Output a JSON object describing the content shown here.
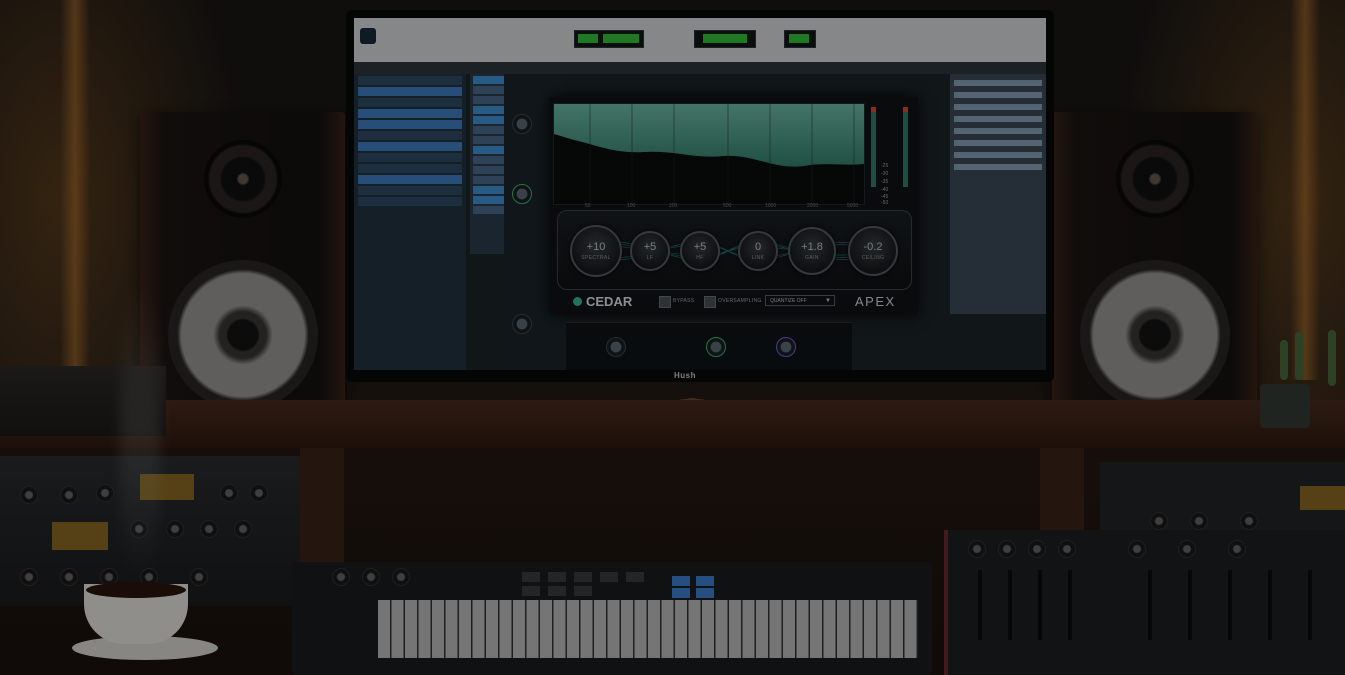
{
  "monitor": {
    "brand": "Hush"
  },
  "plugin": {
    "frequency_labels": [
      "50",
      "100",
      "200",
      "500",
      "1000",
      "2000",
      "5000"
    ],
    "meter_labels": [
      "-25",
      "-30",
      "-35",
      "-40",
      "-45",
      "-50"
    ],
    "knobs": [
      {
        "value": "+10",
        "label": "SPECTRAL"
      },
      {
        "value": "+5",
        "label": "LF"
      },
      {
        "value": "+5",
        "label": "HF"
      },
      {
        "value": "0",
        "label": "LINK"
      },
      {
        "value": "+1.8",
        "label": "GAIN"
      },
      {
        "value": "-0.2",
        "label": "CEILING"
      }
    ],
    "brand": "CEDAR",
    "bypass_label": "BYPASS",
    "oversampling_label": "OVERSAMPLING",
    "quantize_label": "QUANTIZE OFF",
    "product_name": "APEX",
    "colors": {
      "spectrum_fill": "#6fc3ad",
      "accent": "#38b89a",
      "meter_peak": "#f1413a"
    }
  }
}
